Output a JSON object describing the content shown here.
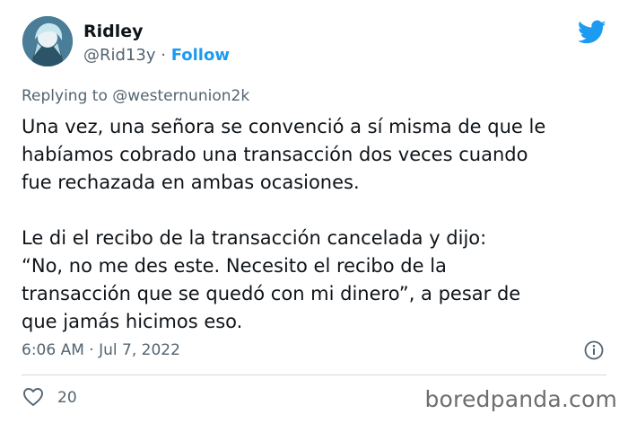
{
  "user": {
    "name": "Ridley",
    "handle": "@Rid13y",
    "separator": "·",
    "follow_label": "Follow"
  },
  "reply": {
    "prefix": "Replying to",
    "mention": "@westernunion2k"
  },
  "tweet": {
    "paragraph1": "Una vez, una señora se convenció a sí misma de que le\nhabíamos cobrado una transacción dos veces cuando\nfue rechazada en ambas ocasiones.",
    "paragraph2": "Le di el recibo de la transacción cancelada y dijo:\n“No, no me des este. Necesito el recibo de la\ntransacción que se quedó con mi dinero”, a pesar de\nque jamás hicimos eso."
  },
  "meta": {
    "timestamp": "6:06 AM · Jul 7, 2022"
  },
  "actions": {
    "like_count": "20"
  },
  "watermark": {
    "text": "boredpanda.com"
  },
  "colors": {
    "twitter_blue": "#1d9bf0",
    "text": "#0f1419",
    "secondary": "#536471"
  },
  "icons": {
    "platform": "twitter-bird-icon",
    "info": "info-icon",
    "like": "heart-icon"
  }
}
